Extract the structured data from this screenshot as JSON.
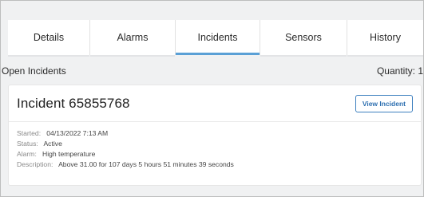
{
  "tabs": [
    {
      "label": "Details",
      "active": false
    },
    {
      "label": "Alarms",
      "active": false
    },
    {
      "label": "Incidents",
      "active": true
    },
    {
      "label": "Sensors",
      "active": false
    },
    {
      "label": "History",
      "active": false
    }
  ],
  "section": {
    "title": "Open Incidents",
    "quantity": "Quantity: 1"
  },
  "incident": {
    "title": "Incident 65855768",
    "view_button": "View Incident",
    "fields": {
      "started_label": "Started:",
      "started_value": "04/13/2022 7:13 AM",
      "status_label": "Status:",
      "status_value": "Active",
      "alarm_label": "Alarm:",
      "alarm_value": "High temperature",
      "description_label": "Description:",
      "description_value": "Above 31.00 for 107 days 5 hours 51 minutes 39 seconds"
    }
  },
  "colors": {
    "accent": "#5aa0d6",
    "button": "#2d6fb0",
    "background": "#f0f1f2"
  }
}
